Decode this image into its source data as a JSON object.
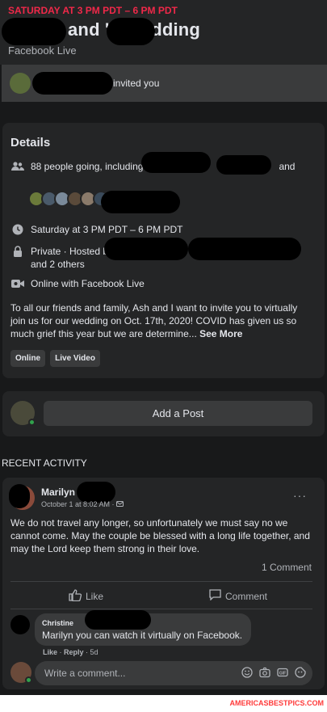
{
  "header": {
    "date_line": "SATURDAY AT 3 PM PDT – 6 PM PDT",
    "title": "and 's Wedding",
    "subtitle": "Facebook Live"
  },
  "invite": {
    "text": "invited you"
  },
  "details": {
    "title": "Details",
    "going_text": "88 people going, including",
    "going_suffix": "and",
    "time_text": "Saturday at 3 PM PDT – 6 PM PDT",
    "privacy_text": "Private · Hosted by",
    "privacy_more": "and 2 others",
    "online_text": "Online with Facebook Live",
    "description": "To all our friends and family, Ash and I want to invite you to virtually join us for our wedding on Oct. 17th, 2020! COVID has given us so much grief this year but we are determine...",
    "see_more": "See More",
    "tags": [
      "Online",
      "Live Video"
    ],
    "facepile_colors": [
      "#6b7a3a",
      "#4a5a6a",
      "#7a8a9a",
      "#5a4a3a",
      "#8a7a6a",
      "#3a4a5a",
      "#6a6a6a",
      "#4a3a3a"
    ]
  },
  "add_post": {
    "label": "Add a Post"
  },
  "recent_activity": {
    "heading": "RECENT ACTIVITY"
  },
  "post": {
    "author": "Marilyn",
    "time": "October 1 at 8:02 AM ·",
    "more": "···",
    "body": "We do not travel any longer, so unfortunately we must say no we cannot come. May the couple be blessed with a long life together, and may the Lord keep them strong in their love.",
    "comment_count": "1 Comment",
    "like_label": "Like",
    "comment_label": "Comment"
  },
  "comment": {
    "author": "Christine",
    "text": "Marilyn you can watch it virtually on Facebook.",
    "like": "Like",
    "reply": "Reply",
    "age": "5d",
    "write_placeholder": "Write a comment..."
  },
  "watermark": "AMERICASBESTPICS.COM",
  "colors": {
    "background": "#18191a",
    "card": "#242526",
    "accent_red": "#f02849",
    "online_green": "#31a24c"
  }
}
